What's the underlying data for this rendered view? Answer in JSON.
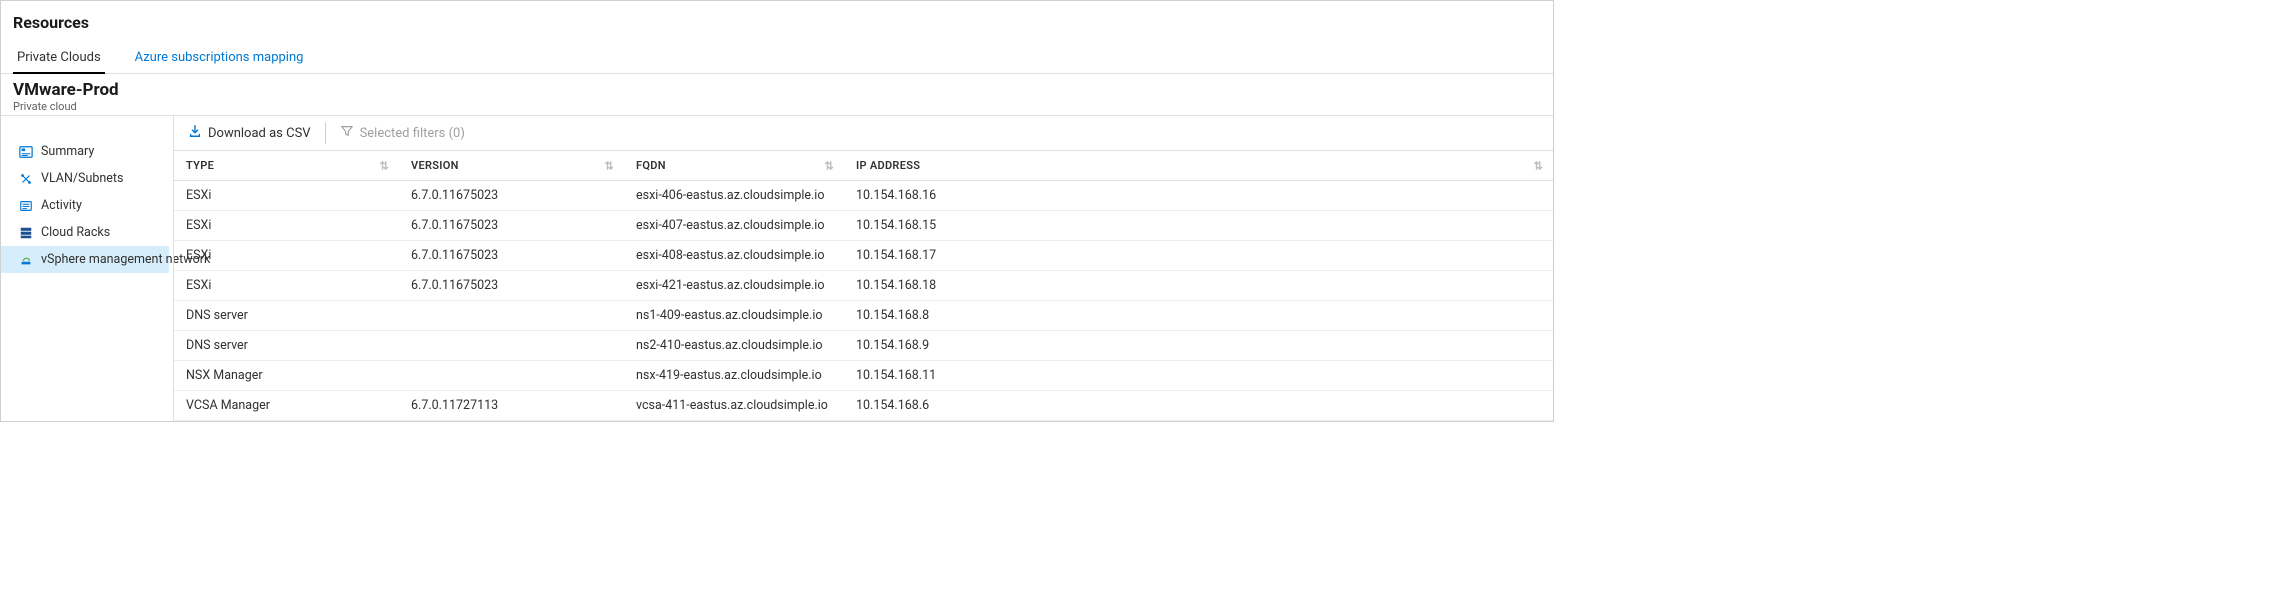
{
  "header": {
    "title": "Resources"
  },
  "tabs": {
    "items": [
      {
        "label": "Private Clouds",
        "active": true
      },
      {
        "label": "Azure subscriptions mapping",
        "active": false
      }
    ]
  },
  "cloud": {
    "name": "VMware-Prod",
    "subtitle": "Private cloud"
  },
  "sidebar": {
    "items": [
      {
        "id": "summary",
        "label": "Summary",
        "icon": "summary-icon",
        "selected": false
      },
      {
        "id": "vlan",
        "label": "VLAN/Subnets",
        "icon": "network-icon",
        "selected": false
      },
      {
        "id": "activity",
        "label": "Activity",
        "icon": "activity-icon",
        "selected": false
      },
      {
        "id": "racks",
        "label": "Cloud Racks",
        "icon": "racks-icon",
        "selected": false
      },
      {
        "id": "vsphere",
        "label": "vSphere management network",
        "icon": "vsphere-icon",
        "selected": true
      }
    ]
  },
  "toolbar": {
    "download_label": "Download as CSV",
    "filters_label": "Selected filters (0)"
  },
  "table": {
    "columns": [
      {
        "key": "type",
        "label": "TYPE"
      },
      {
        "key": "version",
        "label": "VERSION"
      },
      {
        "key": "fqdn",
        "label": "FQDN"
      },
      {
        "key": "ip",
        "label": "IP ADDRESS"
      }
    ],
    "rows": [
      {
        "type": "ESXi",
        "version": "6.7.0.11675023",
        "fqdn": "esxi-406-eastus.az.cloudsimple.io",
        "ip": "10.154.168.16"
      },
      {
        "type": "ESXi",
        "version": "6.7.0.11675023",
        "fqdn": "esxi-407-eastus.az.cloudsimple.io",
        "ip": "10.154.168.15"
      },
      {
        "type": "ESXi",
        "version": "6.7.0.11675023",
        "fqdn": "esxi-408-eastus.az.cloudsimple.io",
        "ip": "10.154.168.17"
      },
      {
        "type": "ESXi",
        "version": "6.7.0.11675023",
        "fqdn": "esxi-421-eastus.az.cloudsimple.io",
        "ip": "10.154.168.18"
      },
      {
        "type": "DNS server",
        "version": "",
        "fqdn": "ns1-409-eastus.az.cloudsimple.io",
        "ip": "10.154.168.8"
      },
      {
        "type": "DNS server",
        "version": "",
        "fqdn": "ns2-410-eastus.az.cloudsimple.io",
        "ip": "10.154.168.9"
      },
      {
        "type": "NSX Manager",
        "version": "",
        "fqdn": "nsx-419-eastus.az.cloudsimple.io",
        "ip": "10.154.168.11"
      },
      {
        "type": "VCSA Manager",
        "version": "6.7.0.11727113",
        "fqdn": "vcsa-411-eastus.az.cloudsimple.io",
        "ip": "10.154.168.6"
      }
    ]
  },
  "colors": {
    "accent": "#0078d4",
    "selected_bg": "#d6eefc"
  }
}
